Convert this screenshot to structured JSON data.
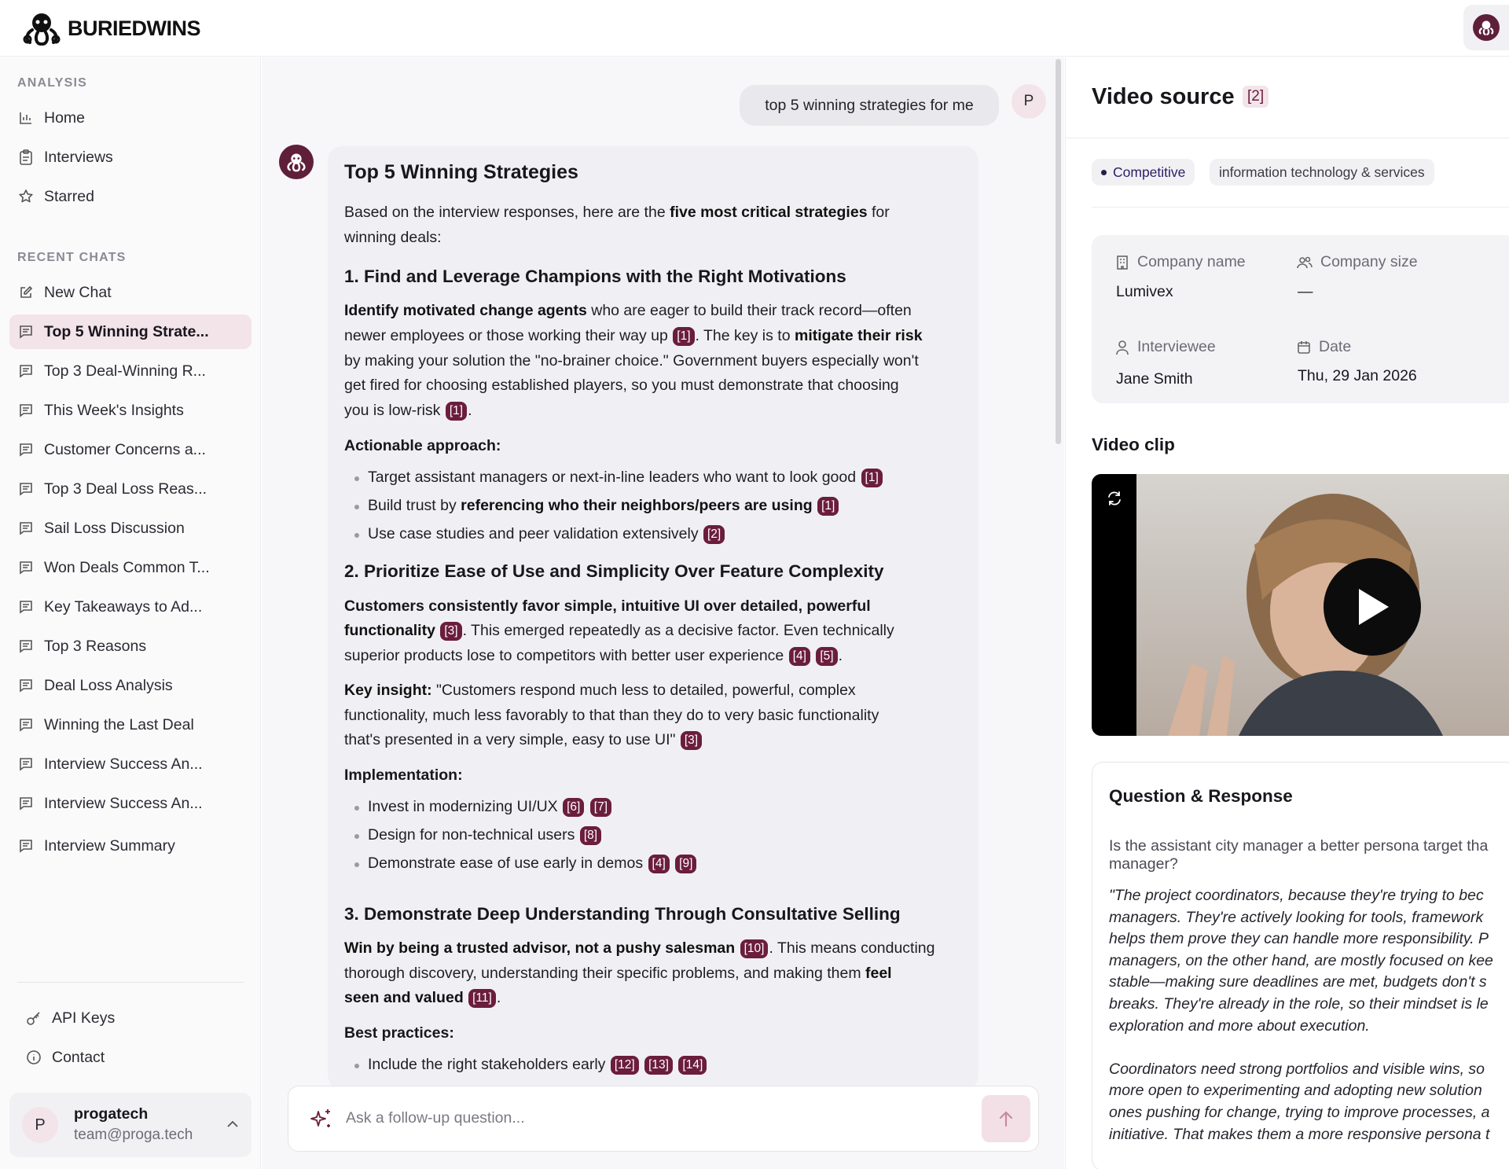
{
  "app": {
    "name": "BURIEDWINS",
    "accent_color": "#6b1d3c",
    "accent_light": "#f3e4e9"
  },
  "sidebar": {
    "analysis_label": "ANALYSIS",
    "nav": [
      {
        "label": "Home",
        "icon": "bar-chart-icon"
      },
      {
        "label": "Interviews",
        "icon": "clipboard-icon"
      },
      {
        "label": "Starred",
        "icon": "star-icon"
      }
    ],
    "recent_label": "RECENT CHATS",
    "new_chat": "New Chat",
    "chats": [
      "Top 5 Winning Strate...",
      "Top 3 Deal-Winning R...",
      "This Week's Insights",
      "Customer Concerns a...",
      "Top 3 Deal Loss Reas...",
      "Sail Loss Discussion",
      "Won Deals Common T...",
      "Key Takeaways to Ad...",
      "Top 3 Reasons",
      "Deal Loss Analysis",
      "Winning the Last Deal",
      "Interview Success An...",
      "Interview Success An...",
      "Interview Summary"
    ],
    "api_keys": "API Keys",
    "contact": "Contact",
    "user": {
      "initial": "P",
      "name": "progatech",
      "email": "team@proga.tech"
    }
  },
  "chat": {
    "user_initial": "P",
    "user_message": "top 5 winning strategies for me",
    "answer": {
      "title": "Top 5 Winning Strategies",
      "intro_a": "Based on the interview responses, here are the ",
      "intro_b": "five most critical strategies",
      "intro_c": " for",
      "intro_d": "winning deals:",
      "s1_title": "1. Find and Leverage Champions with the Right Motivations",
      "s1_p1a": "Identify motivated change agents",
      "s1_p1b": " who are eager to build their track record—often",
      "s1_p2a": "newer employees or those working their way up ",
      "s1_p2b": ". The key is to ",
      "s1_p2c": "mitigate their risk",
      "s1_p3": "by making your solution the \"no-brainer choice.\" Government buyers especially won't",
      "s1_p4": "get fired for choosing established players, so you must demonstrate that choosing",
      "s1_p5": "you is low-risk ",
      "s1_sub": "Actionable approach:",
      "s1_b1": "Target assistant managers or next-in-line leaders who want to look good ",
      "s1_b2a": "Build trust by ",
      "s1_b2b": "referencing who their neighbors/peers are using",
      "s1_b3": "Use case studies and peer validation extensively ",
      "s2_title": "2. Prioritize Ease of Use and Simplicity Over Feature Complexity",
      "s2_p1": "Customers consistently favor simple, intuitive UI over detailed, powerful",
      "s2_p2a": "functionality",
      "s2_p2b": ". This emerged repeatedly as a decisive factor. Even technically",
      "s2_p3": "superior products lose to competitors with better user experience ",
      "s2_k1a": "Key insight:",
      "s2_k1b": " \"Customers respond much less to detailed, powerful, complex",
      "s2_k2": "functionality, much less favorably to that than they do to very basic functionality",
      "s2_k3": "that's presented in a very simple, easy to use UI\" ",
      "s2_sub": "Implementation:",
      "s2_b1": "Invest in modernizing UI/UX ",
      "s2_b2": "Design for non-technical users ",
      "s2_b3": "Demonstrate ease of use early in demos ",
      "s3_title": "3. Demonstrate Deep Understanding Through Consultative Selling",
      "s3_p1a": "Win by being a trusted advisor, not a pushy salesman",
      "s3_p1b": ". This means conducting",
      "s3_p2a": "thorough discovery, understanding their specific problems, and making them ",
      "s3_p2b": "feel",
      "s3_p3": "seen and valued",
      "s3_sub": "Best practices:",
      "s3_b1": "Include the right stakeholders early ",
      "citations": [
        "[1]",
        "[2]",
        "[3]",
        "[4]",
        "[5]",
        "[6]",
        "[7]",
        "[8]",
        "[9]",
        "[10]",
        "[11]",
        "[12]",
        "[13]",
        "[14]"
      ]
    },
    "composer_placeholder": "Ask a follow-up question..."
  },
  "panel": {
    "title": "Video source",
    "badge": "[2]",
    "tags": [
      "Competitive",
      "information technology & services"
    ],
    "company_name_label": "Company name",
    "company_name": "Lumivex",
    "company_size_label": "Company size",
    "company_size": "—",
    "interviewee_label": "Interviewee",
    "interviewee": "Jane Smith",
    "date_label": "Date",
    "date": "Thu, 29 Jan 2026",
    "video_title": "Video clip",
    "qr_title": "Question & Response",
    "question": "Is the assistant city manager a better persona target tha manager?",
    "answer_lines": [
      "\"The project coordinators, because they're trying to bec",
      "managers. They're actively looking for tools, framework",
      "helps them prove they can handle more responsibility. P",
      "managers, on the other hand, are mostly focused on kee",
      "stable—making sure deadlines are met, budgets don't s",
      "breaks. They're already in the role, so their mindset is le",
      "exploration and more about execution.",
      "",
      "Coordinators need strong portfolios and visible wins, so",
      "more open to experimenting and adopting new solution",
      "ones pushing for change, trying to improve processes, a",
      "initiative. That makes them a more responsive persona t"
    ]
  }
}
